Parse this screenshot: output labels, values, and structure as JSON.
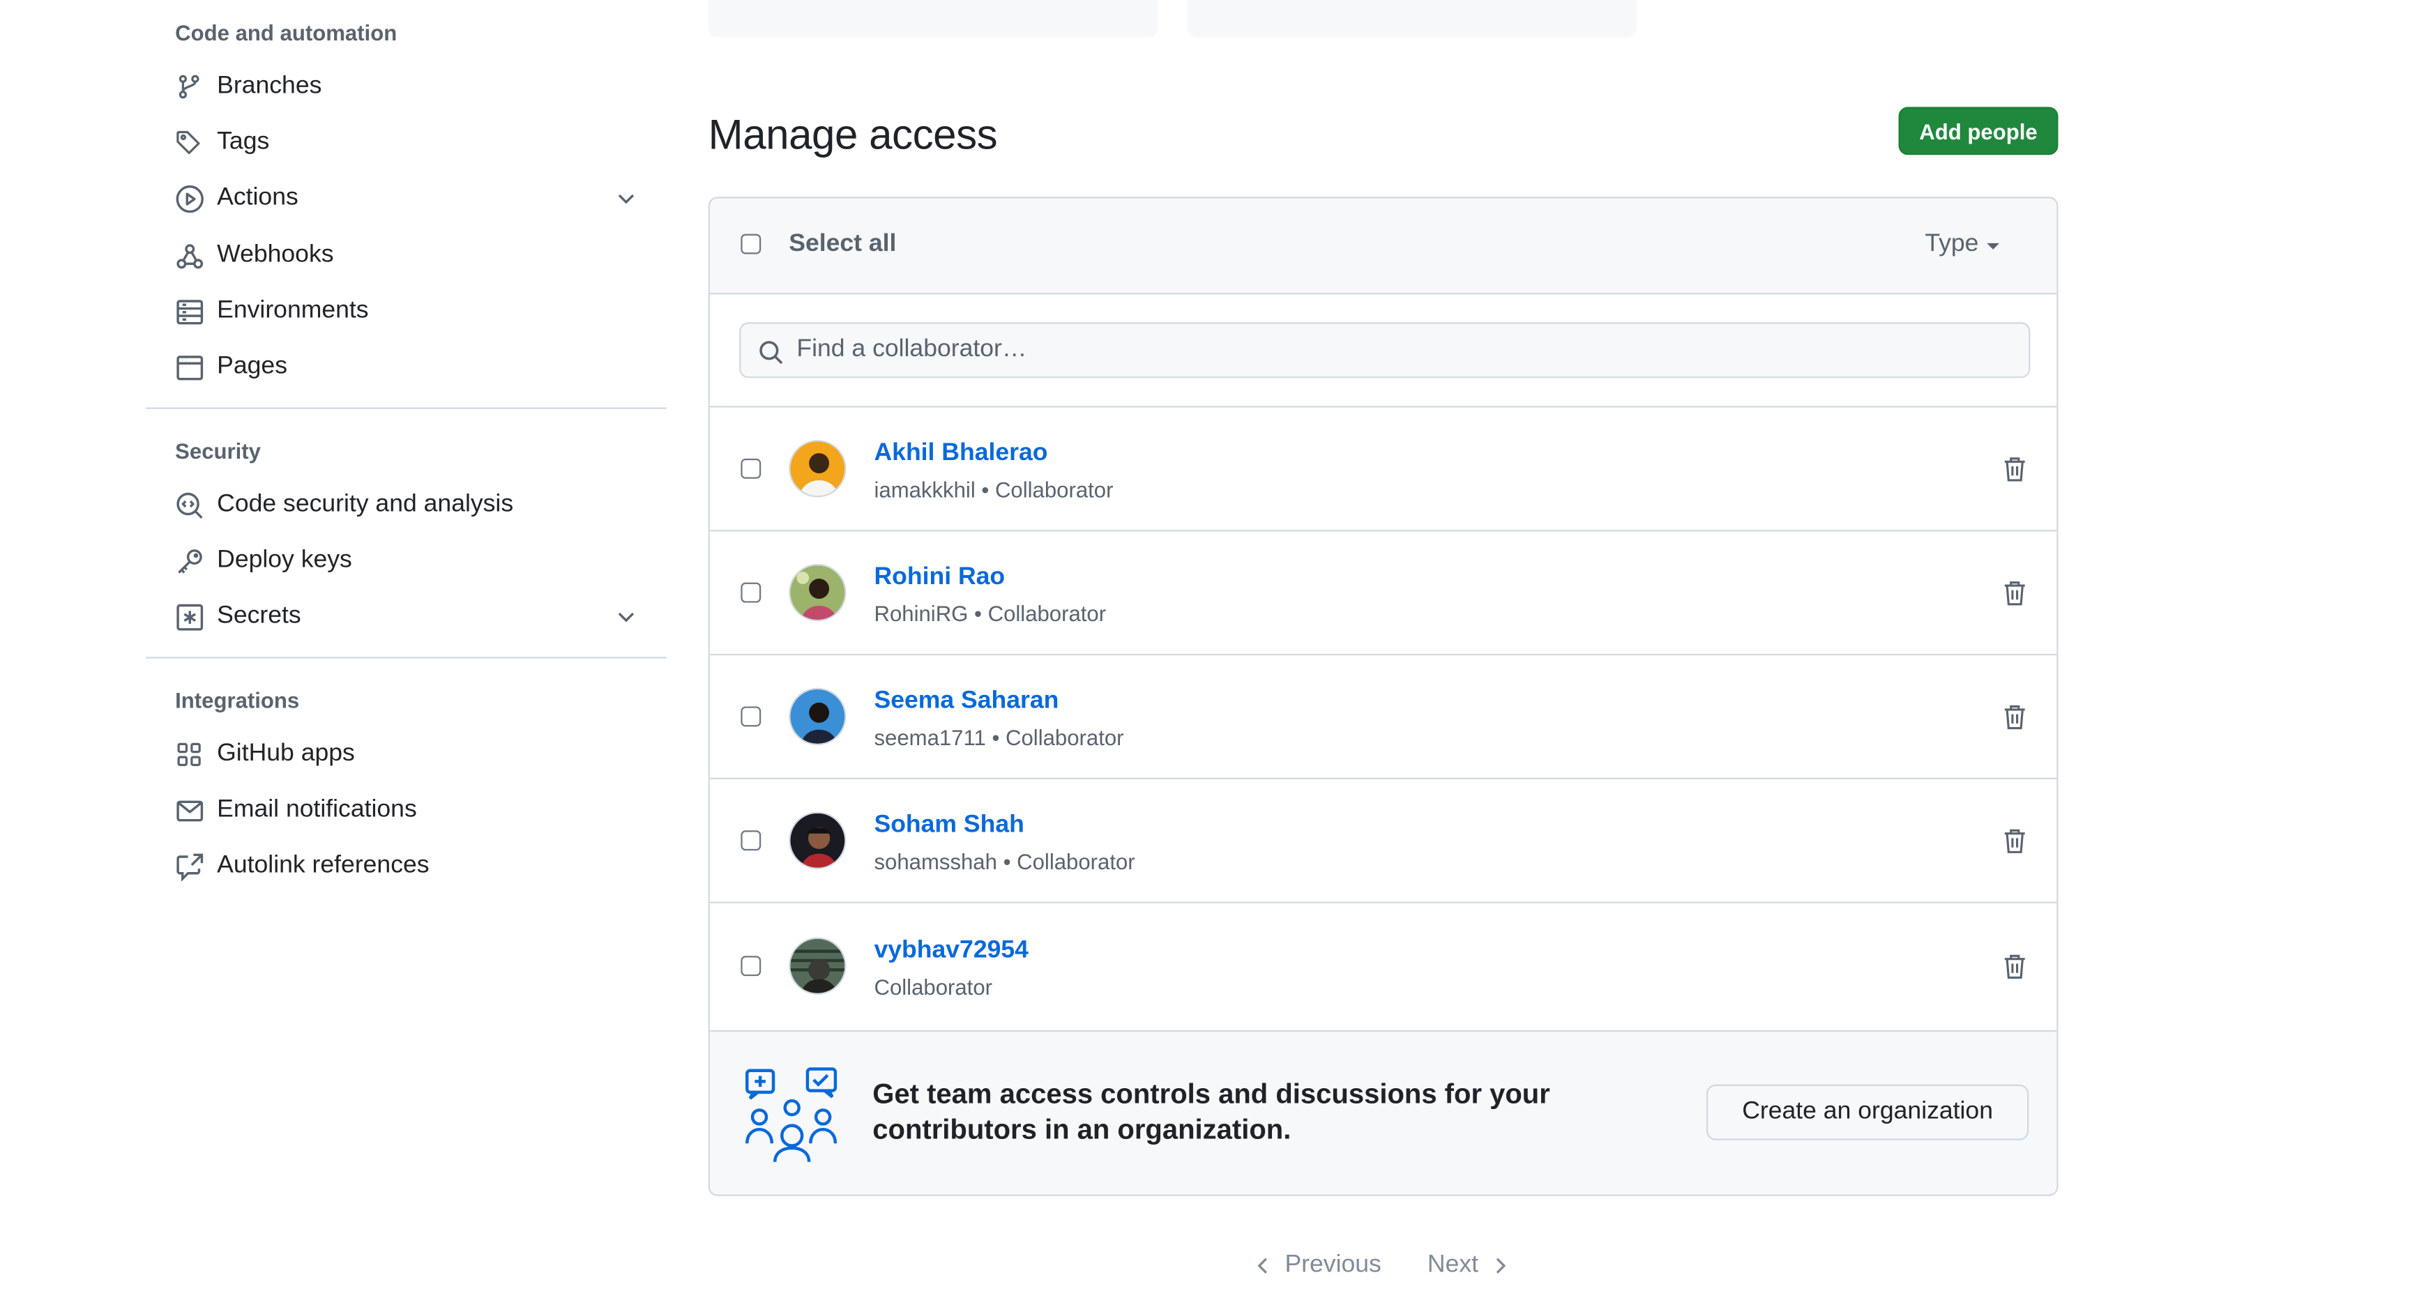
{
  "sidebar": {
    "sections": [
      {
        "heading": "Code and automation",
        "items": [
          {
            "label": "Branches",
            "icon": "git-branch-icon"
          },
          {
            "label": "Tags",
            "icon": "tag-icon"
          },
          {
            "label": "Actions",
            "icon": "play-icon",
            "expandable": true
          },
          {
            "label": "Webhooks",
            "icon": "webhook-icon"
          },
          {
            "label": "Environments",
            "icon": "server-icon"
          },
          {
            "label": "Pages",
            "icon": "browser-icon"
          }
        ]
      },
      {
        "heading": "Security",
        "items": [
          {
            "label": "Code security and analysis",
            "icon": "codescan-icon"
          },
          {
            "label": "Deploy keys",
            "icon": "key-icon"
          },
          {
            "label": "Secrets",
            "icon": "key-asterisk-icon",
            "expandable": true
          }
        ]
      },
      {
        "heading": "Integrations",
        "items": [
          {
            "label": "GitHub apps",
            "icon": "apps-icon"
          },
          {
            "label": "Email notifications",
            "icon": "mail-icon"
          },
          {
            "label": "Autolink references",
            "icon": "cross-reference-icon"
          }
        ]
      }
    ]
  },
  "main": {
    "title": "Manage access",
    "add_button": "Add people",
    "select_all": "Select all",
    "type_filter": "Type",
    "search_placeholder": "Find a collaborator…",
    "collaborators": [
      {
        "name": "Akhil Bhalerao",
        "username": "iamakkkhil",
        "role": "Collaborator"
      },
      {
        "name": "Rohini Rao",
        "username": "RohiniRG",
        "role": "Collaborator"
      },
      {
        "name": "Seema Saharan",
        "username": "seema1711",
        "role": "Collaborator"
      },
      {
        "name": "Soham Shah",
        "username": "sohamsshah",
        "role": "Collaborator"
      },
      {
        "name": "vybhav72954",
        "username": "",
        "role": "Collaborator"
      }
    ],
    "separator": "•",
    "promo_text": "Get team access controls and discussions for your contributors in an organization.",
    "promo_button": "Create an organization"
  },
  "pagination": {
    "previous": "Previous",
    "next": "Next"
  },
  "colors": {
    "accent": "#0969da",
    "primary_button": "#1f883d",
    "muted": "#59636e",
    "border": "#d1d9e0",
    "subtle_bg": "#f6f8fa"
  }
}
